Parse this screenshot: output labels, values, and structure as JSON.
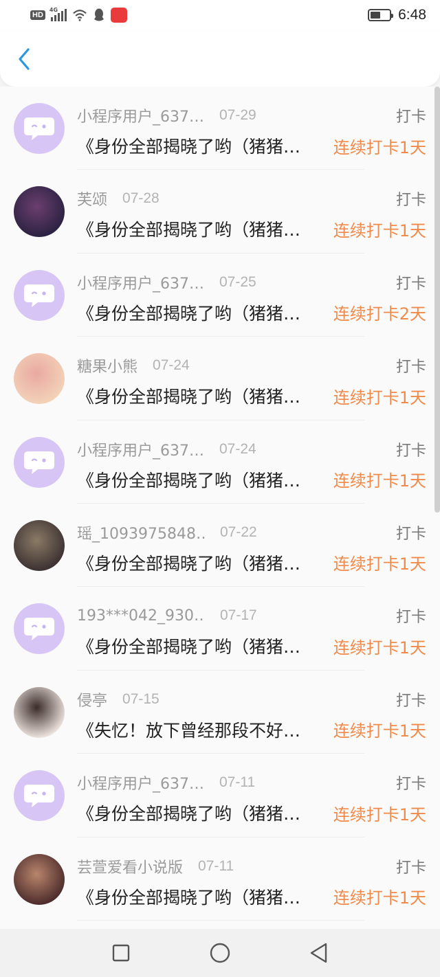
{
  "status_bar": {
    "hd": "HD",
    "network": "4G",
    "time": "6:48",
    "battery_level": 0.55
  },
  "header": {
    "back_icon": "chevron-left-icon",
    "accent": "#2a98e0"
  },
  "colors": {
    "streak": "#f08a4b",
    "avatar_default_bg": "#d7c6f5"
  },
  "items": [
    {
      "username": "小程序用户_637…",
      "date": "07-29",
      "type": "打卡",
      "title": "《身份全部揭晓了哟（猪猪…",
      "streak": "连续打卡1天",
      "avatar": "default"
    },
    {
      "username": "芙颂",
      "date": "07-28",
      "type": "打卡",
      "title": "《身份全部揭晓了哟（猪猪…",
      "streak": "连续打卡1天",
      "avatar": "photo"
    },
    {
      "username": "小程序用户_637…",
      "date": "07-25",
      "type": "打卡",
      "title": "《身份全部揭晓了哟（猪猪…",
      "streak": "连续打卡2天",
      "avatar": "default"
    },
    {
      "username": "糖果小熊",
      "date": "07-24",
      "type": "打卡",
      "title": "《身份全部揭晓了哟（猪猪…",
      "streak": "连续打卡1天",
      "avatar": "photo"
    },
    {
      "username": "小程序用户_637…",
      "date": "07-24",
      "type": "打卡",
      "title": "《身份全部揭晓了哟（猪猪…",
      "streak": "连续打卡1天",
      "avatar": "default"
    },
    {
      "username": "瑶_1093975848…",
      "date": "07-22",
      "type": "打卡",
      "title": "《身份全部揭晓了哟（猪猪…",
      "streak": "连续打卡1天",
      "avatar": "photo"
    },
    {
      "username": "193***042_930…",
      "date": "07-17",
      "type": "打卡",
      "title": "《身份全部揭晓了哟（猪猪…",
      "streak": "连续打卡1天",
      "avatar": "default"
    },
    {
      "username": "侵亭",
      "date": "07-15",
      "type": "打卡",
      "title": "《失忆！放下曾经那段不好…",
      "streak": "连续打卡1天",
      "avatar": "photo"
    },
    {
      "username": "小程序用户_637…",
      "date": "07-11",
      "type": "打卡",
      "title": "《身份全部揭晓了哟（猪猪…",
      "streak": "连续打卡1天",
      "avatar": "default"
    },
    {
      "username": "芸萱爱看小说版",
      "date": "07-11",
      "type": "打卡",
      "title": "《身份全部揭晓了哟（猪猪…",
      "streak": "连续打卡1天",
      "avatar": "photo"
    }
  ],
  "nav": {
    "recent": "square-icon",
    "home": "circle-icon",
    "back": "triangle-back-icon"
  }
}
